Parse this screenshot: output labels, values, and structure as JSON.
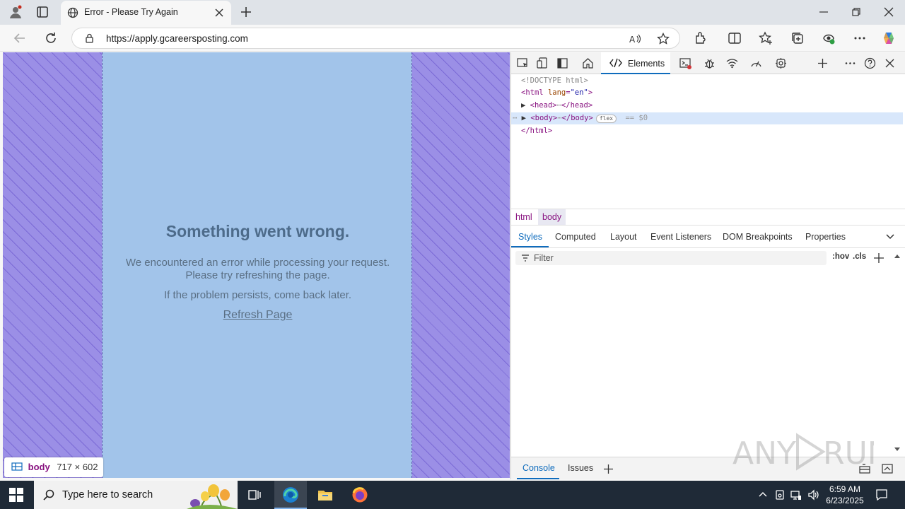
{
  "browser": {
    "tab_title": "Error - Please Try Again",
    "url": "https://apply.gcareersposting.com",
    "icons": [
      "profile-icon",
      "tab-actions-icon",
      "globe-icon",
      "close-icon",
      "plus-icon",
      "minimize-icon",
      "restore-icon",
      "back-icon",
      "refresh-icon",
      "lock-icon",
      "read-aloud-icon",
      "favorite-star-icon",
      "extensions-icon",
      "split-screen-icon",
      "favorites-icon",
      "collections-icon",
      "browser-essentials-icon",
      "more-icon",
      "copilot-icon"
    ]
  },
  "page": {
    "title": "Something went wrong.",
    "message_line1": "We encountered an error while processing your request.",
    "message_line2": "Please try refreshing the page.",
    "message_persist": "If the problem persists, come back later.",
    "refresh_link": "Refresh Page",
    "inspect_badge": {
      "tag": "body",
      "dims": "717 × 602"
    }
  },
  "devtools": {
    "active_tab": "Elements",
    "dom": {
      "doctype": "<!DOCTYPE html>",
      "html_open_tag": "html",
      "html_attr": "lang",
      "html_attr_val": "\"en\"",
      "head_tag": "<head>",
      "head_close": "</head>",
      "body_tag": "<body>",
      "body_close": "</body>",
      "flex_badge": "flex",
      "sel_marker": "== $0",
      "html_close": "</html>",
      "ellipsis": "⋯"
    },
    "breadcrumbs": [
      "html",
      "body"
    ],
    "subtabs": [
      "Styles",
      "Computed",
      "Layout",
      "Event Listeners",
      "DOM Breakpoints",
      "Properties"
    ],
    "filter_placeholder": "Filter",
    "hov": ":hov",
    "cls": ".cls",
    "drawer_tabs": [
      "Console",
      "Issues"
    ]
  },
  "taskbar": {
    "search_placeholder": "Type here to search",
    "time": "6:59 AM",
    "date": "6/23/2025"
  },
  "watermark": "ANY RUN"
}
